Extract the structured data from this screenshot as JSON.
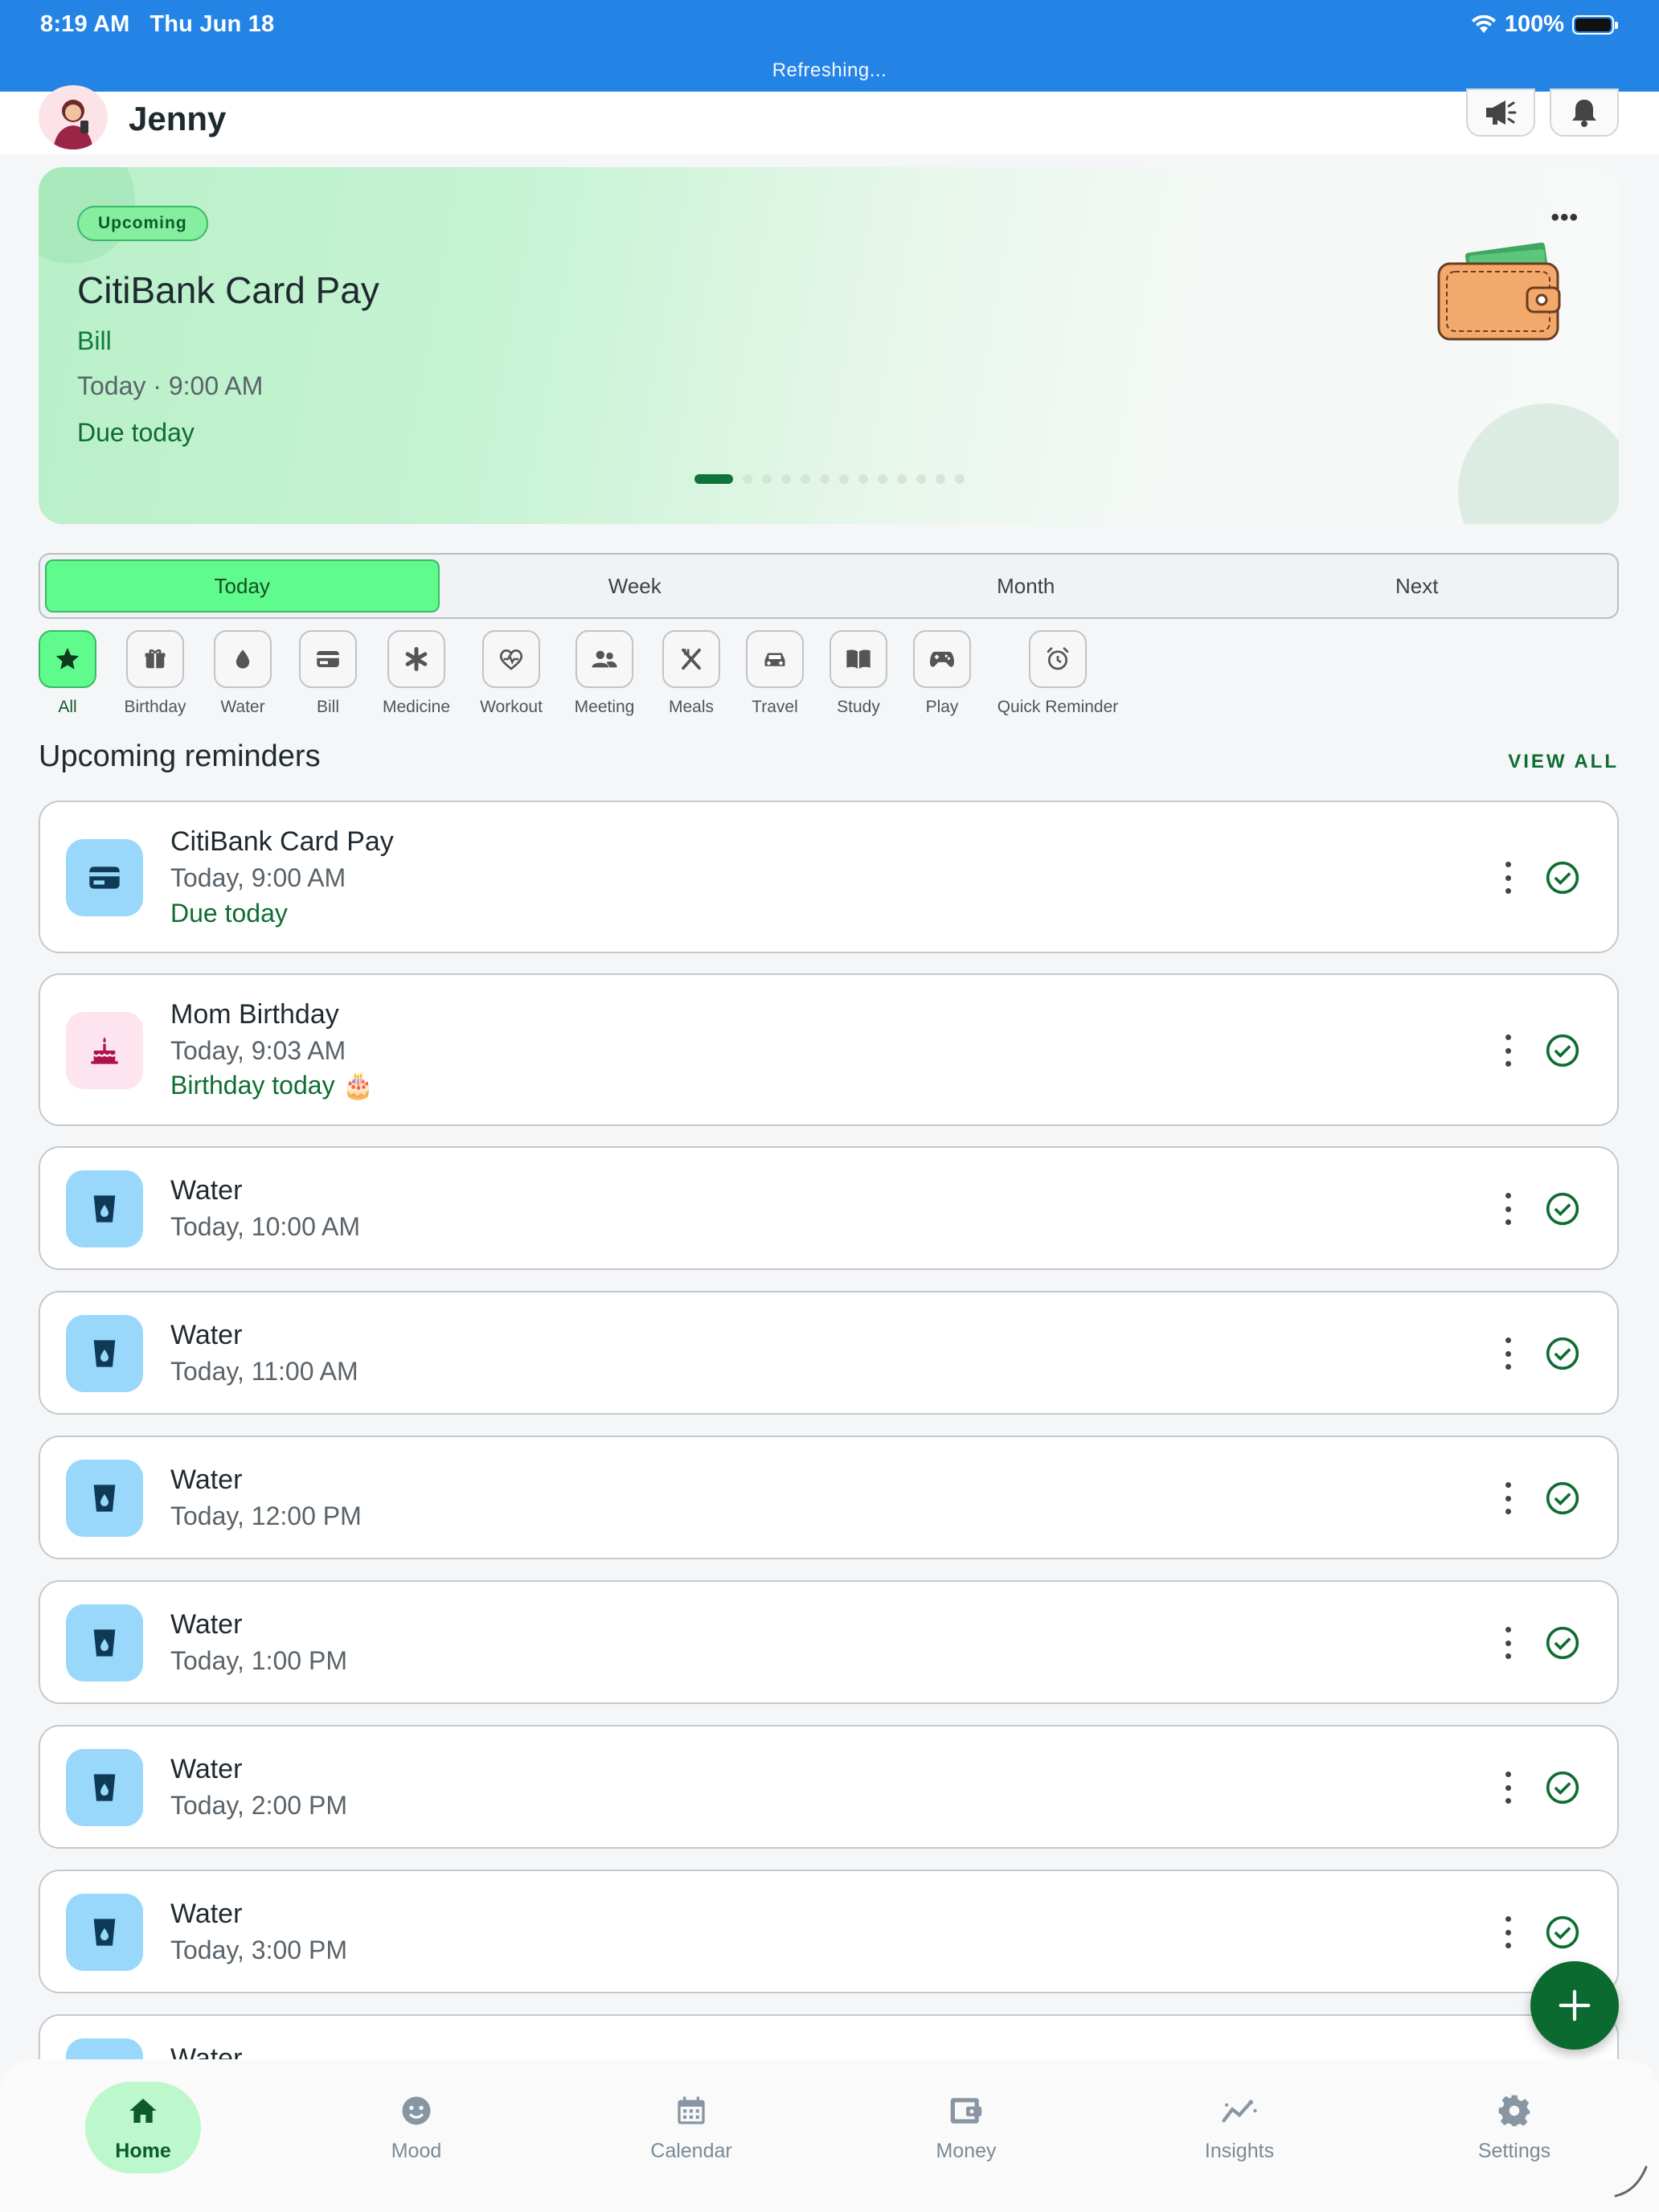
{
  "status_bar": {
    "time": "8:19 AM",
    "date": "Thu Jun 18",
    "battery": "100%",
    "refresh_text": "Refreshing..."
  },
  "header": {
    "user_name": "Jenny"
  },
  "hero": {
    "badge": "Upcoming",
    "title": "CitiBank Card Pay",
    "category": "Bill",
    "time": "Today · 9:00 AM",
    "status": "Due today",
    "more_icon": "•••",
    "page_index": 1,
    "page_count": 13
  },
  "tabs": [
    {
      "label": "Today",
      "active": true
    },
    {
      "label": "Week",
      "active": false
    },
    {
      "label": "Month",
      "active": false
    },
    {
      "label": "Next",
      "active": false
    }
  ],
  "categories": [
    {
      "label": "All",
      "icon": "star-icon",
      "active": true
    },
    {
      "label": "Birthday",
      "icon": "gift-icon"
    },
    {
      "label": "Water",
      "icon": "droplet-icon"
    },
    {
      "label": "Bill",
      "icon": "card-icon"
    },
    {
      "label": "Medicine",
      "icon": "asterisk-icon"
    },
    {
      "label": "Workout",
      "icon": "heart-pulse-icon"
    },
    {
      "label": "Meeting",
      "icon": "people-icon"
    },
    {
      "label": "Meals",
      "icon": "utensils-icon"
    },
    {
      "label": "Travel",
      "icon": "car-icon"
    },
    {
      "label": "Study",
      "icon": "book-icon"
    },
    {
      "label": "Play",
      "icon": "gamepad-icon"
    },
    {
      "label": "Quick Reminder",
      "icon": "alarm-icon"
    }
  ],
  "section": {
    "title": "Upcoming reminders",
    "view_all": "VIEW ALL"
  },
  "reminders": [
    {
      "title": "CitiBank Card Pay",
      "time": "Today, 9:00 AM",
      "status": "Due today",
      "icon": "card-icon"
    },
    {
      "title": "Mom Birthday",
      "time": "Today, 9:03 AM",
      "status": "Birthday today 🎂",
      "icon": "cake-icon"
    },
    {
      "title": "Water",
      "time": "Today, 10:00 AM",
      "icon": "water-glass-icon"
    },
    {
      "title": "Water",
      "time": "Today, 11:00 AM",
      "icon": "water-glass-icon"
    },
    {
      "title": "Water",
      "time": "Today, 12:00 PM",
      "icon": "water-glass-icon"
    },
    {
      "title": "Water",
      "time": "Today, 1:00 PM",
      "icon": "water-glass-icon"
    },
    {
      "title": "Water",
      "time": "Today, 2:00 PM",
      "icon": "water-glass-icon"
    },
    {
      "title": "Water",
      "time": "Today, 3:00 PM",
      "icon": "water-glass-icon"
    },
    {
      "title": "Water",
      "time": "",
      "icon": "water-glass-icon"
    }
  ],
  "nav": [
    {
      "label": "Home",
      "icon": "home-icon",
      "active": true
    },
    {
      "label": "Mood",
      "icon": "smiley-icon"
    },
    {
      "label": "Calendar",
      "icon": "calendar-icon"
    },
    {
      "label": "Money",
      "icon": "wallet-icon"
    },
    {
      "label": "Insights",
      "icon": "trend-icon"
    },
    {
      "label": "Settings",
      "icon": "gear-icon"
    }
  ],
  "colors": {
    "brand_green": "#0e6d31",
    "active_green": "#5ffb8d",
    "status_blue": "#2484e6",
    "water_bg": "#99d8fb",
    "birthday_bg": "#fde4ee"
  }
}
